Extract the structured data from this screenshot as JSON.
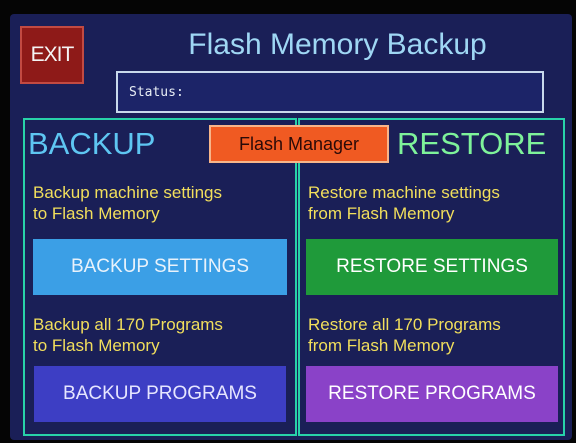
{
  "header": {
    "exit_label": "EXIT",
    "title": "Flash Memory Backup",
    "status_label": "Status:"
  },
  "backup": {
    "title": "BACKUP",
    "settings_desc_line1": "Backup machine settings",
    "settings_desc_line2": "to Flash Memory",
    "settings_button": "BACKUP SETTINGS",
    "programs_desc_line1": "Backup all 170 Programs",
    "programs_desc_line2": "to Flash Memory",
    "programs_button": "BACKUP PROGRAMS"
  },
  "flash_manager_label": "Flash Manager",
  "restore": {
    "title": "RESTORE",
    "settings_desc_line1": "Restore machine settings",
    "settings_desc_line2": "from Flash Memory",
    "settings_button": "RESTORE SETTINGS",
    "programs_desc_line1": "Restore all 170 Programs",
    "programs_desc_line2": "from Flash Memory",
    "programs_button": "RESTORE PROGRAMS"
  },
  "colors": {
    "background": "#1a1f57",
    "exit": "#8e1a18",
    "flash_manager": "#f05a22",
    "backup_settings": "#3b9fe6",
    "restore_settings": "#1f9a3a",
    "backup_programs": "#3d3ec4",
    "restore_programs": "#8a42c8",
    "panel_border": "#28d1a9",
    "description_text": "#f2df5c"
  }
}
